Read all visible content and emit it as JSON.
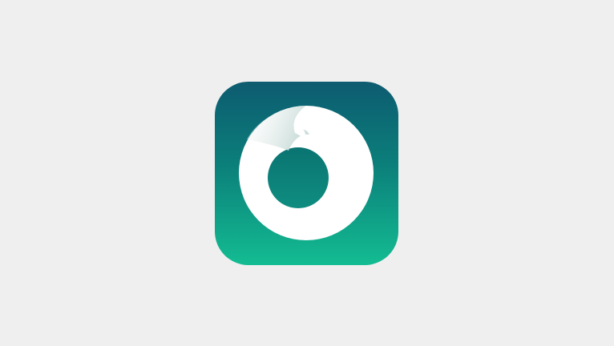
{
  "icon": {
    "name": "app-logo",
    "gradient_top": "#0d5b70",
    "gradient_mid": "#0b7f7a",
    "gradient_bottom": "#13bc92",
    "ring_color": "#ffffff",
    "fold_shade": "#c9dcd8"
  }
}
